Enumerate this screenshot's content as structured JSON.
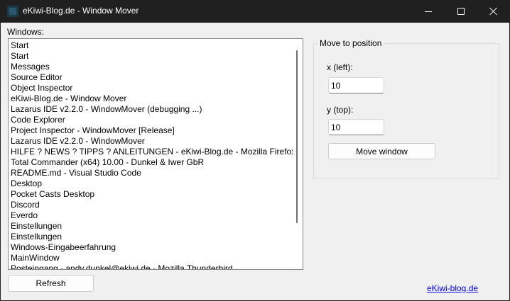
{
  "window": {
    "title": "eKiwi-Blog.de - Window Mover"
  },
  "windows_list": {
    "label": "Windows:",
    "items": [
      "Start",
      "Start",
      "Messages",
      "Source Editor",
      "Object Inspector",
      "eKiwi-Blog.de - Window Mover",
      "Lazarus IDE v2.2.0 - WindowMover (debugging ...)",
      "Code Explorer",
      "Project Inspector - WindowMover [Release]",
      "Lazarus IDE v2.2.0 - WindowMover",
      "HILFE ? NEWS ? TIPPS ? ANLEITUNGEN - eKiwi-Blog.de - Mozilla Firefox",
      "Total Commander (x64) 10.00 - Dunkel & Iwer GbR",
      "README.md - Visual Studio Code",
      "Desktop",
      "Pocket Casts Desktop",
      "Discord",
      "Everdo",
      "Einstellungen",
      "Einstellungen",
      "Windows-Eingabeerfahrung",
      "MainWindow",
      "Posteingang - andy.dunkel@ekiwi.de - Mozilla Thunderbird"
    ]
  },
  "move_group": {
    "title": "Move to position",
    "x_label": "x (left):",
    "x_value": "10",
    "y_label": "y (top):",
    "y_value": "10",
    "move_button": "Move window"
  },
  "refresh_button": "Refresh",
  "footer_link": "eKiwi-blog.de"
}
